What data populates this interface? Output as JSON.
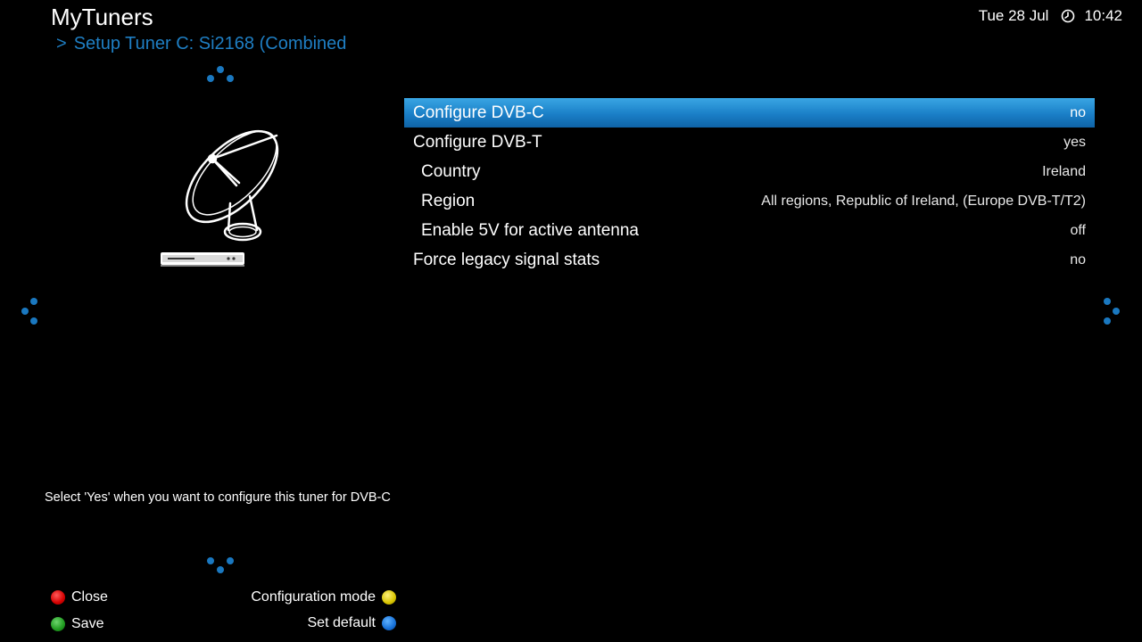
{
  "header": {
    "app_title": "MyTuners",
    "breadcrumb_separator": ">",
    "breadcrumb": "Setup Tuner C: Si2168 (Combined",
    "date": "Tue 28 Jul",
    "time": "10:42",
    "clock_icon": "clock-icon"
  },
  "illustration": {
    "icon": "satellite-dish-receiver-icon"
  },
  "settings": [
    {
      "label": "Configure DVB-C",
      "value": "no",
      "selected": true,
      "indent": false
    },
    {
      "label": "Configure DVB-T",
      "value": "yes",
      "selected": false,
      "indent": false
    },
    {
      "label": "Country",
      "value": "Ireland",
      "selected": false,
      "indent": true
    },
    {
      "label": "Region",
      "value": "All regions, Republic of Ireland, (Europe DVB-T/T2)",
      "selected": false,
      "indent": true
    },
    {
      "label": "Enable 5V for active antenna",
      "value": "off",
      "selected": false,
      "indent": true
    },
    {
      "label": "Force legacy signal stats",
      "value": "no",
      "selected": false,
      "indent": false
    }
  ],
  "help_text": "Select 'Yes' when you want to configure this tuner for DVB-C",
  "key_hints": {
    "red": "Close",
    "green": "Save",
    "yellow": "Configuration mode",
    "blue": "Set default"
  },
  "colors": {
    "accent": "#1f7fc4",
    "selection_top": "#3aa6e4",
    "selection_bottom": "#0f63a6",
    "red_key": "#d40000",
    "green_key": "#1f9a1f",
    "yellow_key": "#d8c400",
    "blue_key": "#1670d8"
  }
}
